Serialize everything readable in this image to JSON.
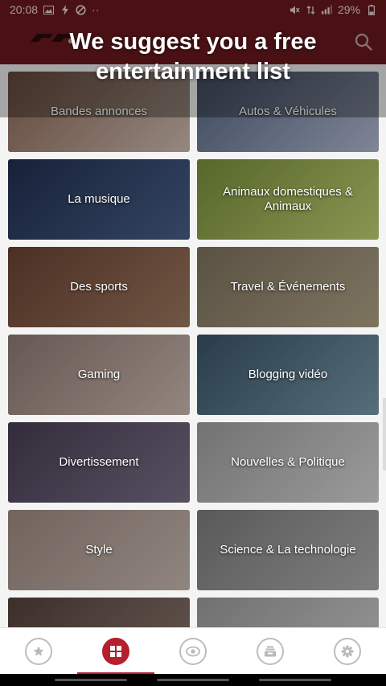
{
  "status_bar": {
    "time": "20:08",
    "overflow": "··",
    "battery": "29%"
  },
  "banner": {
    "line1": "We suggest you a free",
    "line2": "entertainment list"
  },
  "categories": [
    {
      "label": "Bandes annonces",
      "colors": [
        "#7a5a4a",
        "#b6a69c"
      ]
    },
    {
      "label": "Autos & Véhicules",
      "colors": [
        "#4d5a72",
        "#9aa3b8"
      ]
    },
    {
      "label": "La musique",
      "colors": [
        "#1d2a46",
        "#3f5478"
      ]
    },
    {
      "label": "Animaux domestiques & Animaux",
      "colors": [
        "#6a7e34",
        "#a8b865"
      ]
    },
    {
      "label": "Des sports",
      "colors": [
        "#5e3a2c",
        "#8a6a55"
      ]
    },
    {
      "label": "Travel & Événements",
      "colors": [
        "#6e6452",
        "#9a8e76"
      ]
    },
    {
      "label": "Gaming",
      "colors": [
        "#7c6b64",
        "#b5a49c"
      ]
    },
    {
      "label": "Blogging vidéo",
      "colors": [
        "#334a5a",
        "#6a8796"
      ]
    },
    {
      "label": "Divertissement",
      "colors": [
        "#3e3648",
        "#6a6478"
      ]
    },
    {
      "label": "Nouvelles & Politique",
      "colors": [
        "#8c8c8c",
        "#bdbdbd"
      ]
    },
    {
      "label": "Style",
      "colors": [
        "#8c7a72",
        "#b0a39c"
      ]
    },
    {
      "label": "Science & La technologie",
      "colors": [
        "#6e6e6e",
        "#9a9a9a"
      ]
    },
    {
      "label": "",
      "colors": [
        "#4a3a34",
        "#7c6a62"
      ]
    },
    {
      "label": "",
      "colors": [
        "#8a8a8a",
        "#b8b8b8"
      ]
    }
  ],
  "bottom_nav": [
    {
      "icon": "star-icon",
      "active": false
    },
    {
      "icon": "grid-icon",
      "active": true
    },
    {
      "icon": "eye-icon",
      "active": false
    },
    {
      "icon": "inbox-icon",
      "active": false
    },
    {
      "icon": "settings-icon",
      "active": false
    }
  ],
  "colors": {
    "appbar": "#6e1a1f",
    "accent": "#b51f2e"
  }
}
